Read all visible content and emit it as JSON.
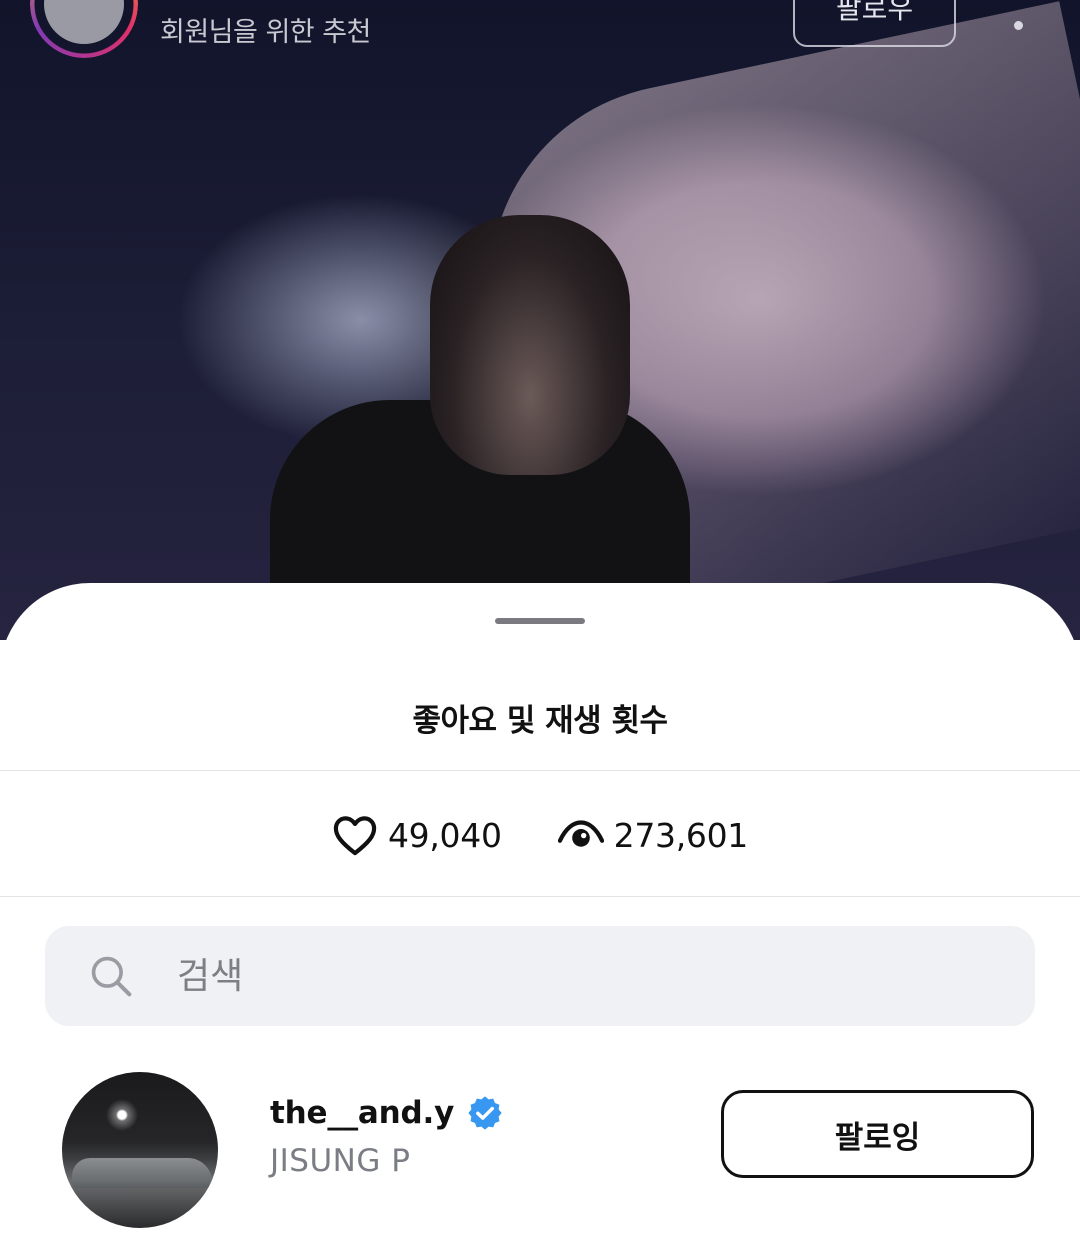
{
  "header": {
    "subtitle": "회원님을 위한 추천",
    "follow_label": "팔로우",
    "more_icon": "more-vertical-icon"
  },
  "sheet": {
    "title": "좋아요 및 재생 횟수",
    "stats": {
      "likes": {
        "icon": "heart-icon",
        "value": "49,040"
      },
      "views": {
        "icon": "eye-icon",
        "value": "273,601"
      }
    },
    "search": {
      "icon": "search-icon",
      "placeholder": "검색",
      "value": ""
    },
    "users": [
      {
        "handle": "the__and.y",
        "verified": true,
        "name": "JISUNG P",
        "button_label": "팔로잉"
      }
    ]
  },
  "colors": {
    "verified_badge": "#3897f0",
    "text_primary": "#111111",
    "text_secondary": "#7b7d85",
    "search_bg": "#f0f1f4"
  }
}
